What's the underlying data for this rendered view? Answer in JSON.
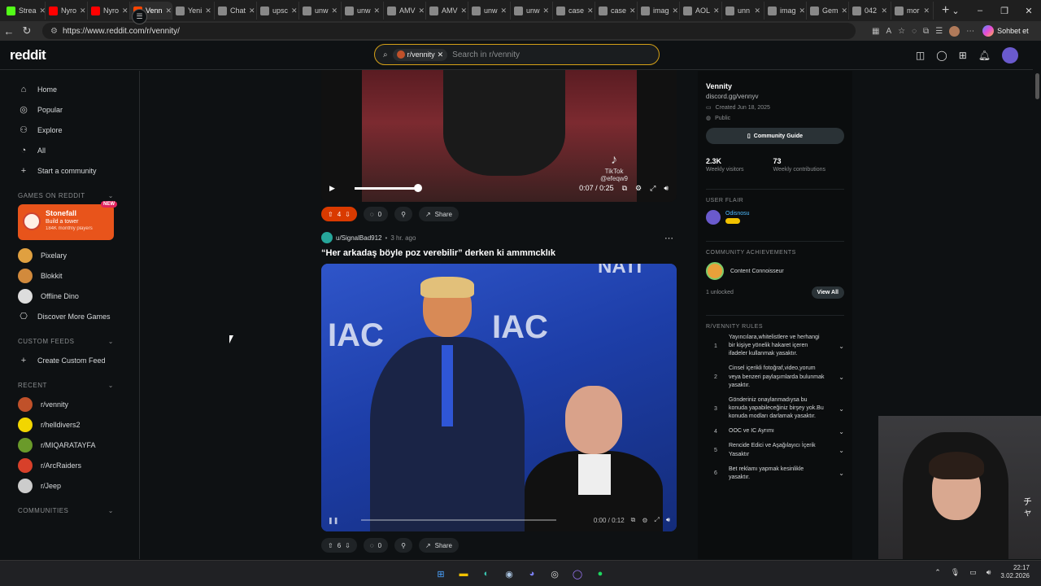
{
  "browser": {
    "tabs": [
      {
        "label": "Strea",
        "color": "#53fc18"
      },
      {
        "label": "Nyro",
        "color": "#ff0000"
      },
      {
        "label": "Nyro",
        "color": "#ff0000"
      },
      {
        "label": "Venn",
        "color": "#ff4500",
        "active": true
      },
      {
        "label": "Yeni",
        "color": "#888888"
      },
      {
        "label": "Chat",
        "color": "#888888"
      },
      {
        "label": "upsc",
        "color": "#888888"
      },
      {
        "label": "unw",
        "color": "#888888"
      },
      {
        "label": "unw",
        "color": "#888888"
      },
      {
        "label": "AMV",
        "color": "#888888"
      },
      {
        "label": "AMV",
        "color": "#888888"
      },
      {
        "label": "unw",
        "color": "#888888"
      },
      {
        "label": "unw",
        "color": "#888888"
      },
      {
        "label": "case",
        "color": "#888888"
      },
      {
        "label": "case",
        "color": "#888888"
      },
      {
        "label": "imag",
        "color": "#888888"
      },
      {
        "label": "AOL",
        "color": "#888888"
      },
      {
        "label": "unn",
        "color": "#888888"
      },
      {
        "label": "imag",
        "color": "#888888"
      },
      {
        "label": "Gem",
        "color": "#888888"
      },
      {
        "label": "042",
        "color": "#888888"
      },
      {
        "label": "mor",
        "color": "#888888"
      }
    ],
    "url": "https://www.reddit.com/r/vennity/",
    "copilot_label": "Sohbet et"
  },
  "header": {
    "logo": "reddit",
    "search_chip": "r/vennity",
    "search_placeholder": "Search in r/vennity"
  },
  "sidebar": {
    "nav": [
      {
        "label": "Home",
        "icon": "home-icon",
        "glyph": "⌂"
      },
      {
        "label": "Popular",
        "icon": "popular-icon",
        "glyph": "◎"
      },
      {
        "label": "Explore",
        "icon": "explore-icon",
        "glyph": "⚇"
      },
      {
        "label": "All",
        "icon": "all-icon",
        "glyph": "◔"
      },
      {
        "label": "Start a community",
        "icon": "plus-icon",
        "glyph": "+"
      }
    ],
    "games_title": "GAMES ON REDDIT",
    "featured_game": {
      "name": "Stonefall",
      "tagline": "Build a tower",
      "users": "184K monthly players",
      "badge": "NEW"
    },
    "games": [
      {
        "label": "Pixelary",
        "color": "#e0a040"
      },
      {
        "label": "Blokkit",
        "color": "#d28a3c"
      },
      {
        "label": "Offline Dino",
        "color": "#dddddd"
      },
      {
        "label": "Discover More Games",
        "color": ""
      }
    ],
    "custom_feeds_title": "CUSTOM FEEDS",
    "create_feed": "Create Custom Feed",
    "recent_title": "RECENT",
    "recent": [
      {
        "label": "r/vennity",
        "color": "#c0512a"
      },
      {
        "label": "r/helldivers2",
        "color": "#f2d600"
      },
      {
        "label": "r/MIQARATAYFA",
        "color": "#6a9a2a"
      },
      {
        "label": "r/ArcRaiders",
        "color": "#d8402a"
      },
      {
        "label": "r/Jeep",
        "color": "#cccccc"
      }
    ],
    "communities_title": "COMMUNITIES"
  },
  "feed": {
    "post1": {
      "votes": "4",
      "comments": "0",
      "share": "Share",
      "time": "0:07 / 0:25",
      "watermark": "TikTok",
      "watermark_user": "@efeqw9",
      "progress": 0.28
    },
    "post2": {
      "author": "u/SignalBad912",
      "time_ago": "3 hr. ago",
      "title": "“Her arkadaş böyle poz verebilir” derken ki ammmcklık",
      "votes": "6",
      "comments": "0",
      "share": "Share",
      "video_time": "0:00 / 0:12",
      "progress": 0
    }
  },
  "community": {
    "name": "Vennity",
    "link": "discord.gg/vennyv",
    "created": "Created Jun 18, 2025",
    "visibility": "Public",
    "guide_btn": "Community Guide",
    "visitors": "2.3K",
    "visitors_label": "Weekly visitors",
    "contribs": "73",
    "contribs_label": "Weekly contributions",
    "flair_title": "USER FLAIR",
    "flair_user": "Odisnosu",
    "ach_title": "COMMUNITY ACHIEVEMENTS",
    "ach_name": "Content Connoisseur",
    "ach_unlocked": "1 unlocked",
    "view_all": "View All",
    "rules_title": "R/VENNITY RULES",
    "rules": [
      {
        "n": "1",
        "text": "Yayıncılara,whitelistlere ve herhangi bir kişiye yönelik hakaret içeren ifadeler kullanmak yasaktır."
      },
      {
        "n": "2",
        "text": "Cinsel içerikli fotoğraf,video,yorum veya benzeri paylaşımlarda bulunmak yasaktır."
      },
      {
        "n": "3",
        "text": "Gönderiniz onaylanmadıysa bu konuda yapabileceğiniz birşey yok.Bu konuda modları darlamak yasaktır."
      },
      {
        "n": "4",
        "text": "OOC ve IC Ayrımı"
      },
      {
        "n": "5",
        "text": "Rencide Edici ve Aşağılayıcı İçerik Yasaktır"
      },
      {
        "n": "6",
        "text": "Bet reklamı yapmak kesinlikle yasaktır."
      }
    ]
  },
  "webcam": {
    "overlay": "チャ"
  },
  "taskbar": {
    "time": "22:17",
    "date": "3.02.2026"
  }
}
